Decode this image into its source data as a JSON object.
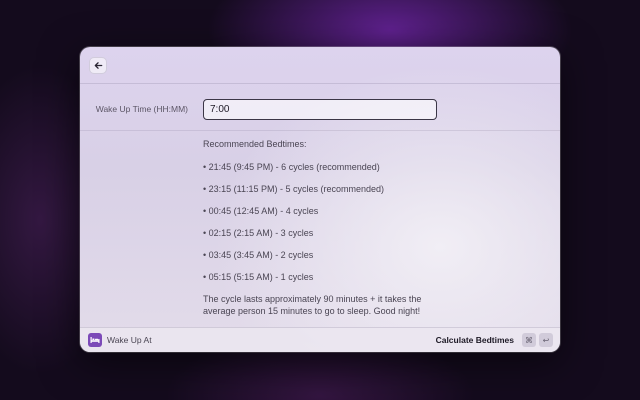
{
  "window": {
    "back_icon": "arrow-left-icon"
  },
  "form": {
    "label": "Wake Up Time (HH:MM)",
    "value": "7:00"
  },
  "results": {
    "heading": "Recommended Bedtimes:",
    "items": [
      "• 21:45 (9:45 PM) - 6 cycles (recommended)",
      "• 23:15 (11:15 PM) - 5 cycles (recommended)",
      "• 00:45 (12:45 AM) - 4 cycles",
      "• 02:15 (2:15 AM) - 3 cycles",
      "• 03:45 (3:45 AM) - 2 cycles",
      "• 05:15 (5:15 AM) - 1 cycles"
    ],
    "note": "The cycle lasts approximately 90 minutes + it takes the average person 15 minutes to go to sleep. Good night!"
  },
  "footer": {
    "app_icon": "bed-icon",
    "app_name": "Wake Up At",
    "action_label": "Calculate Bedtimes",
    "shortcut_cmd": "⌘",
    "shortcut_enter": "↩"
  },
  "colors": {
    "accent": "#7c4ab8"
  }
}
